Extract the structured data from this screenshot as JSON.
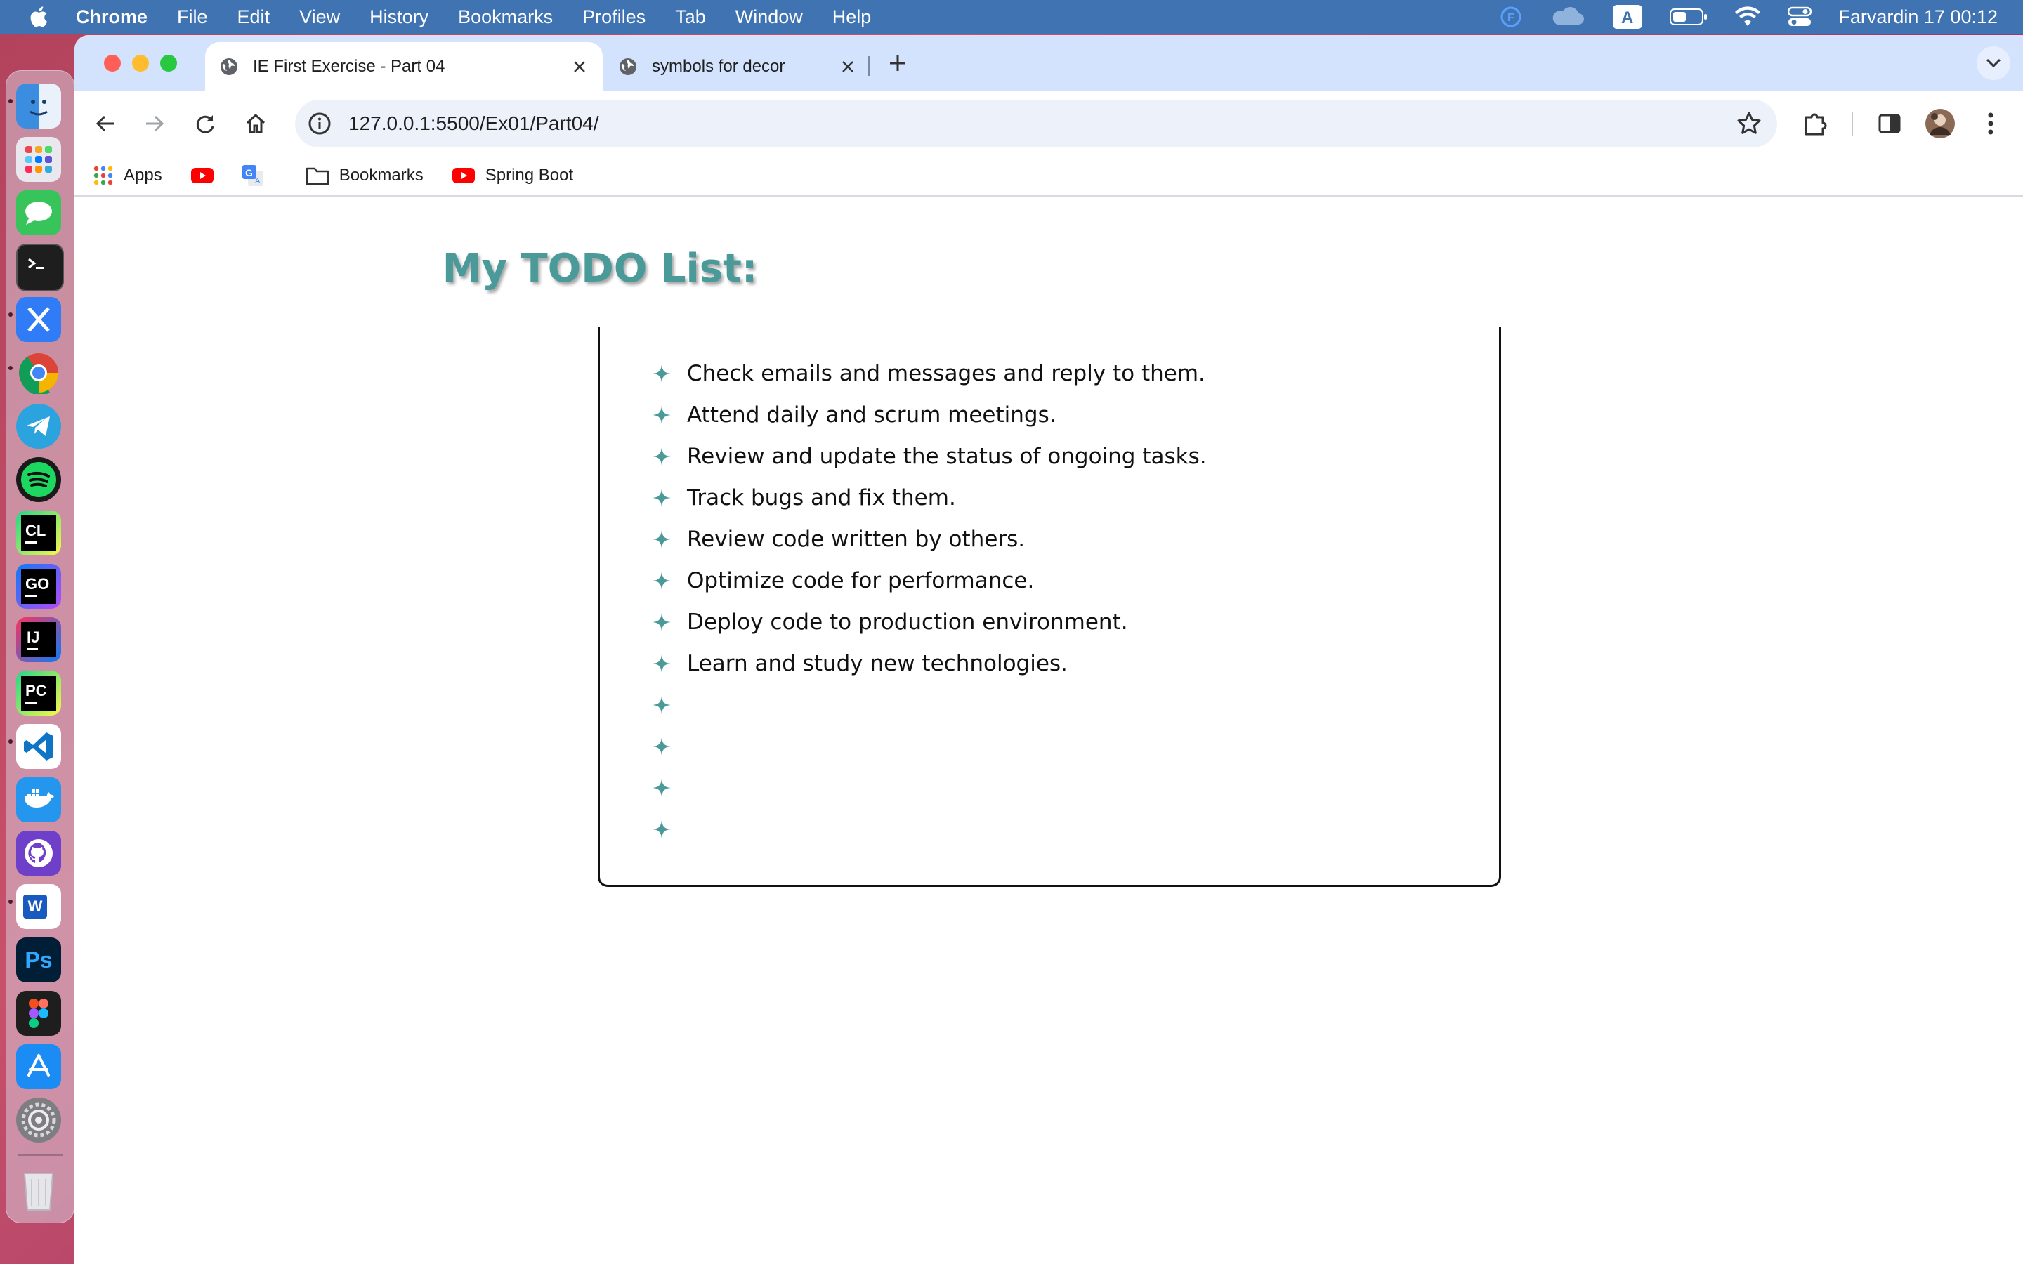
{
  "menubar": {
    "app_name": "Chrome",
    "menus": [
      "File",
      "Edit",
      "View",
      "History",
      "Bookmarks",
      "Profiles",
      "Tab",
      "Window",
      "Help"
    ],
    "input_source": "A",
    "clock": "Farvardin 17  00:12"
  },
  "dock": {
    "apps": [
      {
        "name": "finder",
        "color": "#3b8de0"
      },
      {
        "name": "launchpad",
        "color": "#e8e8ee"
      },
      {
        "name": "messages",
        "color": "#37c45a"
      },
      {
        "name": "terminal",
        "color": "#1e1e1e"
      },
      {
        "name": "xcode-like",
        "color": "#2f7cf6"
      },
      {
        "name": "chrome",
        "color": "#ffffff"
      },
      {
        "name": "telegram",
        "color": "#2aa3df"
      },
      {
        "name": "spotify",
        "color": "#1a1a1a"
      },
      {
        "name": "clion",
        "label": "CL",
        "color": "#1e1e1e"
      },
      {
        "name": "goland",
        "label": "GO",
        "color": "#1e1e1e"
      },
      {
        "name": "intellij",
        "label": "IJ",
        "color": "#1e1e1e"
      },
      {
        "name": "pycharm",
        "label": "PC",
        "color": "#1e1e1e"
      },
      {
        "name": "vscode",
        "color": "#ffffff"
      },
      {
        "name": "docker",
        "color": "#2496ed"
      },
      {
        "name": "github-desktop",
        "color": "#6e40c9"
      },
      {
        "name": "word",
        "label": "W",
        "color": "#185abd"
      },
      {
        "name": "photoshop",
        "label": "Ps",
        "color": "#001e36"
      },
      {
        "name": "figma",
        "color": "#1e1e1e"
      },
      {
        "name": "app-store",
        "color": "#1c8cf5"
      },
      {
        "name": "system-settings",
        "color": "#7d7d82"
      },
      {
        "name": "trash",
        "color": "#e6e6ea"
      }
    ]
  },
  "browser": {
    "tabs": [
      {
        "title": "IE First Exercise - Part 04",
        "active": true
      },
      {
        "title": "symbols for decor",
        "active": false
      }
    ],
    "url": "127.0.0.1:5500/Ex01/Part04/",
    "bookmarks": [
      {
        "label": "Apps",
        "icon": "apps-grid-icon"
      },
      {
        "label": "",
        "icon": "youtube-icon"
      },
      {
        "label": "",
        "icon": "google-translate-icon"
      },
      {
        "label": "Bookmarks",
        "icon": "folder-icon"
      },
      {
        "label": "Spring Boot",
        "icon": "youtube-icon"
      }
    ]
  },
  "page": {
    "title": "My TODO List:",
    "items": [
      "Check emails and messages and reply to them.",
      "Attend daily and scrum meetings.",
      "Review and update the status of ongoing tasks.",
      "Track bugs and fix them.",
      "Review code written by others.",
      "Optimize code for performance.",
      "Deploy code to production environment.",
      "Learn and study new technologies.",
      "",
      "",
      "",
      ""
    ],
    "accent_color": "#4a9a9a"
  }
}
